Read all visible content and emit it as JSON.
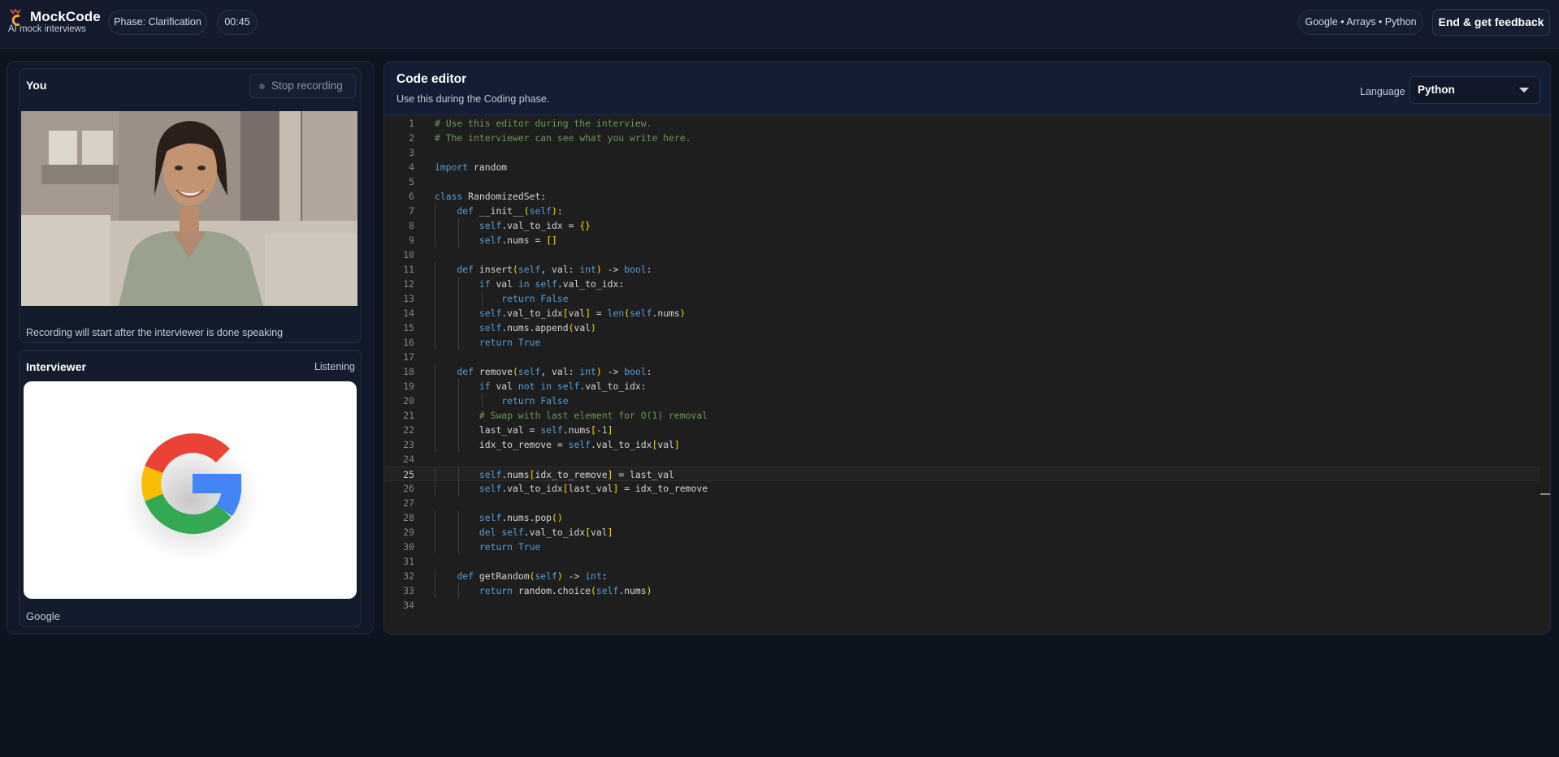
{
  "header": {
    "brand": "MockCode",
    "subtitle": "AI mock interviews",
    "phase": "Phase: Clarification",
    "timer": "00:45",
    "context": "Google • Arrays • Python",
    "end_button": "End & get feedback"
  },
  "you_panel": {
    "title": "You",
    "stop_button": "Stop recording",
    "caption": "Recording will start after the interviewer is done speaking"
  },
  "interviewer_panel": {
    "title": "Interviewer",
    "status": "Listening",
    "name": "Google"
  },
  "editor": {
    "title": "Code editor",
    "subtitle": "Use this during the Coding phase.",
    "language_label": "Language",
    "language": "Python",
    "active_line": 25,
    "lines": [
      [
        [
          "# Use this editor during the interview.",
          "comment"
        ]
      ],
      [
        [
          "# The interviewer can see what you write here.",
          "comment"
        ]
      ],
      [],
      [
        [
          "import",
          "keyword"
        ],
        [
          " random",
          "default"
        ]
      ],
      [],
      [
        [
          "class",
          "keyword"
        ],
        [
          " RandomizedSet:",
          "default"
        ]
      ],
      [
        [
          "    ",
          "default"
        ],
        [
          "def",
          "keyword"
        ],
        [
          " __init__",
          "default"
        ],
        [
          "(",
          "bracket"
        ],
        [
          "self",
          "self"
        ],
        [
          ")",
          "bracket"
        ],
        [
          ":",
          "default"
        ]
      ],
      [
        [
          "        ",
          "default"
        ],
        [
          "self",
          "self"
        ],
        [
          ".val_to_idx = ",
          "default"
        ],
        [
          "{}",
          "bracket"
        ]
      ],
      [
        [
          "        ",
          "default"
        ],
        [
          "self",
          "self"
        ],
        [
          ".nums = ",
          "default"
        ],
        [
          "[]",
          "bracket"
        ]
      ],
      [],
      [
        [
          "    ",
          "default"
        ],
        [
          "def",
          "keyword"
        ],
        [
          " insert",
          "default"
        ],
        [
          "(",
          "bracket"
        ],
        [
          "self",
          "self"
        ],
        [
          ", val: ",
          "default"
        ],
        [
          "int",
          "builtin"
        ],
        [
          ")",
          "bracket"
        ],
        [
          " -> ",
          "default"
        ],
        [
          "bool",
          "builtin"
        ],
        [
          ":",
          "default"
        ]
      ],
      [
        [
          "        ",
          "default"
        ],
        [
          "if",
          "flow"
        ],
        [
          " val ",
          "default"
        ],
        [
          "in",
          "keyword"
        ],
        [
          " ",
          "default"
        ],
        [
          "self",
          "self"
        ],
        [
          ".val_to_idx:",
          "default"
        ]
      ],
      [
        [
          "            ",
          "default"
        ],
        [
          "return",
          "flow"
        ],
        [
          " ",
          "default"
        ],
        [
          "False",
          "keyword"
        ]
      ],
      [
        [
          "        ",
          "default"
        ],
        [
          "self",
          "self"
        ],
        [
          ".val_to_idx",
          "default"
        ],
        [
          "[",
          "bracket"
        ],
        [
          "val",
          "default"
        ],
        [
          "]",
          "bracket"
        ],
        [
          " = ",
          "default"
        ],
        [
          "len",
          "builtin"
        ],
        [
          "(",
          "bracket"
        ],
        [
          "self",
          "self"
        ],
        [
          ".nums",
          "default"
        ],
        [
          ")",
          "bracket"
        ]
      ],
      [
        [
          "        ",
          "default"
        ],
        [
          "self",
          "self"
        ],
        [
          ".nums.append",
          "default"
        ],
        [
          "(",
          "bracket"
        ],
        [
          "val",
          "default"
        ],
        [
          ")",
          "bracket"
        ]
      ],
      [
        [
          "        ",
          "default"
        ],
        [
          "return",
          "flow"
        ],
        [
          " ",
          "default"
        ],
        [
          "True",
          "keyword"
        ]
      ],
      [],
      [
        [
          "    ",
          "default"
        ],
        [
          "def",
          "keyword"
        ],
        [
          " remove",
          "default"
        ],
        [
          "(",
          "bracket"
        ],
        [
          "self",
          "self"
        ],
        [
          ", val: ",
          "default"
        ],
        [
          "int",
          "builtin"
        ],
        [
          ")",
          "bracket"
        ],
        [
          " -> ",
          "default"
        ],
        [
          "bool",
          "builtin"
        ],
        [
          ":",
          "default"
        ]
      ],
      [
        [
          "        ",
          "default"
        ],
        [
          "if",
          "flow"
        ],
        [
          " val ",
          "default"
        ],
        [
          "not in",
          "keyword"
        ],
        [
          " ",
          "default"
        ],
        [
          "self",
          "self"
        ],
        [
          ".val_to_idx:",
          "default"
        ]
      ],
      [
        [
          "            ",
          "default"
        ],
        [
          "return",
          "flow"
        ],
        [
          " ",
          "default"
        ],
        [
          "False",
          "keyword"
        ]
      ],
      [
        [
          "        ",
          "default"
        ],
        [
          "# Swap with last element for O(1) removal",
          "comment"
        ]
      ],
      [
        [
          "        ",
          "default"
        ],
        [
          "last_val = ",
          "default"
        ],
        [
          "self",
          "self"
        ],
        [
          ".nums",
          "default"
        ],
        [
          "[",
          "bracket"
        ],
        [
          "-1",
          "number"
        ],
        [
          "]",
          "bracket"
        ]
      ],
      [
        [
          "        ",
          "default"
        ],
        [
          "idx_to_remove = ",
          "default"
        ],
        [
          "self",
          "self"
        ],
        [
          ".val_to_idx",
          "default"
        ],
        [
          "[",
          "bracket"
        ],
        [
          "val",
          "default"
        ],
        [
          "]",
          "bracket"
        ]
      ],
      [],
      [
        [
          "        ",
          "default"
        ],
        [
          "self",
          "self"
        ],
        [
          ".nums",
          "default"
        ],
        [
          "[",
          "bracket"
        ],
        [
          "idx_to_remove",
          "default"
        ],
        [
          "]",
          "bracket"
        ],
        [
          " = last_val",
          "default"
        ]
      ],
      [
        [
          "        ",
          "default"
        ],
        [
          "self",
          "self"
        ],
        [
          ".val_to_idx",
          "default"
        ],
        [
          "[",
          "bracket"
        ],
        [
          "last_val",
          "default"
        ],
        [
          "]",
          "bracket"
        ],
        [
          " = idx_to_remove",
          "default"
        ]
      ],
      [],
      [
        [
          "        ",
          "default"
        ],
        [
          "self",
          "self"
        ],
        [
          ".nums.pop",
          "default"
        ],
        [
          "()",
          "bracket"
        ]
      ],
      [
        [
          "        ",
          "default"
        ],
        [
          "del",
          "keyword"
        ],
        [
          " ",
          "default"
        ],
        [
          "self",
          "self"
        ],
        [
          ".val_to_idx",
          "default"
        ],
        [
          "[",
          "bracket"
        ],
        [
          "val",
          "default"
        ],
        [
          "]",
          "bracket"
        ]
      ],
      [
        [
          "        ",
          "default"
        ],
        [
          "return",
          "flow"
        ],
        [
          " ",
          "default"
        ],
        [
          "True",
          "keyword"
        ]
      ],
      [],
      [
        [
          "    ",
          "default"
        ],
        [
          "def",
          "keyword"
        ],
        [
          " getRandom",
          "default"
        ],
        [
          "(",
          "bracket"
        ],
        [
          "self",
          "self"
        ],
        [
          ")",
          "bracket"
        ],
        [
          " -> ",
          "default"
        ],
        [
          "int",
          "builtin"
        ],
        [
          ":",
          "default"
        ]
      ],
      [
        [
          "        ",
          "default"
        ],
        [
          "return",
          "flow"
        ],
        [
          " random.choice",
          "default"
        ],
        [
          "(",
          "bracket"
        ],
        [
          "self",
          "self"
        ],
        [
          ".nums",
          "default"
        ],
        [
          ")",
          "bracket"
        ]
      ],
      []
    ]
  },
  "colors": {
    "background": "#0e1320",
    "panel": "#111827",
    "editor_bg": "#1e1e1e",
    "comment": "#6a9955",
    "keyword": "#569cd6",
    "bracket": "#ffd700",
    "text": "#d4d4d4",
    "line_number": "#858585"
  },
  "icons": {
    "brand": "mockcode-logo-icon",
    "stop": "record-dot-icon",
    "dropdown": "chevron-down-icon",
    "avatar": "google-g-logo"
  }
}
